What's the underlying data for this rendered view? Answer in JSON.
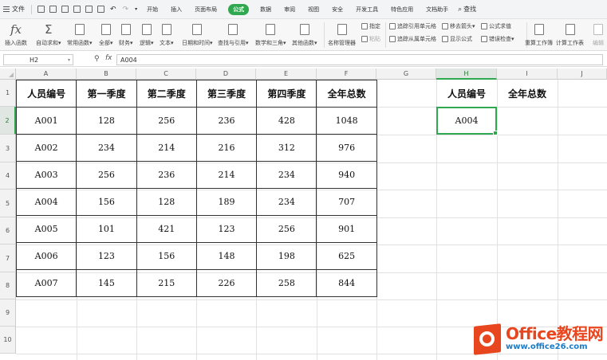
{
  "menubar": {
    "file_label": "文件",
    "tabs": [
      "开始",
      "插入",
      "页面布局",
      "公式",
      "数据",
      "审阅",
      "视图",
      "安全",
      "开发工具",
      "特色应用",
      "文档助手"
    ],
    "active_tab": "公式",
    "search_label": "查找"
  },
  "ribbon": {
    "insert_function": "插入函数",
    "autosum": "自动求和",
    "common_functions": "常用函数",
    "all": "全部",
    "finance": "财务",
    "logic": "逻辑",
    "text": "文本",
    "datetime": "日期和时间",
    "lookup": "查找与引用",
    "math": "数学和三角",
    "other": "其他函数",
    "name_manager": "名称管理器",
    "specify": "指定",
    "paste": "粘贴",
    "trace_precedents": "追踪引用单元格",
    "trace_dependents": "追踪从属单元格",
    "remove_arrows": "移去箭头",
    "show_formulas": "显示公式",
    "formula_eval": "公式求值",
    "error_check": "错误检查",
    "recalc_workbook": "重算工作簿",
    "calc_sheet": "计算工作表",
    "extra": "编辑"
  },
  "formula_bar": {
    "name_box": "H2",
    "fx": "fx",
    "value": "A004"
  },
  "columns": [
    "A",
    "B",
    "C",
    "D",
    "E",
    "F",
    "G",
    "H",
    "I",
    "J"
  ],
  "rows": [
    "1",
    "2",
    "3",
    "4",
    "5",
    "6",
    "7",
    "8",
    "9",
    "10"
  ],
  "table": {
    "headers": [
      "人员编号",
      "第一季度",
      "第二季度",
      "第三季度",
      "第四季度",
      "全年总数"
    ],
    "rows": [
      [
        "A001",
        "128",
        "256",
        "236",
        "428",
        "1048"
      ],
      [
        "A002",
        "234",
        "214",
        "216",
        "312",
        "976"
      ],
      [
        "A003",
        "256",
        "236",
        "214",
        "234",
        "940"
      ],
      [
        "A004",
        "156",
        "128",
        "189",
        "234",
        "707"
      ],
      [
        "A005",
        "101",
        "421",
        "123",
        "256",
        "901"
      ],
      [
        "A006",
        "123",
        "156",
        "148",
        "198",
        "625"
      ],
      [
        "A007",
        "145",
        "215",
        "226",
        "258",
        "844"
      ]
    ]
  },
  "lookup": {
    "id_header": "人员编号",
    "total_header": "全年总数",
    "id_value": "A004"
  },
  "watermark": {
    "title": "Office教程网",
    "url": "www.office26.com"
  },
  "colors": {
    "accent_green": "#2fa84f",
    "watermark_orange": "#e8461f",
    "watermark_blue": "#1a7cc7"
  }
}
